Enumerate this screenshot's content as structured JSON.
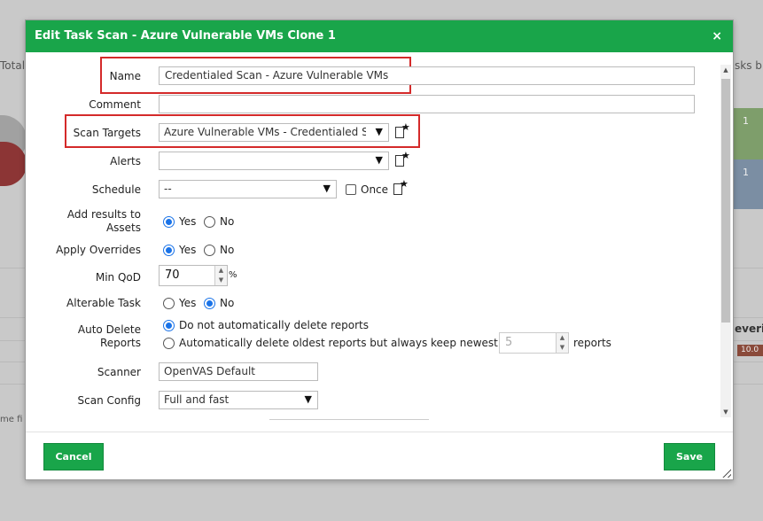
{
  "background": {
    "left_label": "Total:",
    "right_label": "sks b",
    "chart_values": [
      "1",
      "1"
    ],
    "right_header": "everit",
    "severity_badge": "10.0",
    "left_footer_fragment": "me fi"
  },
  "dialog": {
    "title": "Edit Task Scan - Azure Vulnerable VMs Clone 1",
    "close_label": "×",
    "fields": {
      "name": {
        "label": "Name",
        "value": "Credentialed Scan - Azure Vulnerable VMs"
      },
      "comment": {
        "label": "Comment",
        "value": ""
      },
      "scan_targets": {
        "label": "Scan Targets",
        "value": "Azure Vulnerable VMs - Credentialed Sc"
      },
      "alerts": {
        "label": "Alerts",
        "value": ""
      },
      "schedule": {
        "label": "Schedule",
        "value": "--",
        "once_label": "Once",
        "once_checked": false
      },
      "add_results": {
        "label_line1": "Add results to",
        "label_line2": "Assets",
        "options": [
          "Yes",
          "No"
        ],
        "selected": "Yes"
      },
      "apply_overrides": {
        "label": "Apply Overrides",
        "options": [
          "Yes",
          "No"
        ],
        "selected": "Yes"
      },
      "min_qod": {
        "label": "Min QoD",
        "value": "70",
        "unit": "%"
      },
      "alterable_task": {
        "label": "Alterable Task",
        "options": [
          "Yes",
          "No"
        ],
        "selected": "No"
      },
      "auto_delete": {
        "label_line1": "Auto Delete",
        "label_line2": "Reports",
        "option_none": "Do not automatically delete reports",
        "option_keep": "Automatically delete oldest reports but always keep newest",
        "keep_value": "5",
        "keep_unit": "reports",
        "selected": "none"
      },
      "scanner": {
        "label": "Scanner",
        "value": "OpenVAS Default"
      },
      "scan_config": {
        "label": "Scan Config",
        "value": "Full and fast"
      }
    },
    "icons": {
      "arrow": "▼",
      "star": "★",
      "scroll_up": "▲",
      "scroll_down": "▼"
    },
    "footer": {
      "cancel_label": "Cancel",
      "save_label": "Save"
    }
  },
  "colors": {
    "header_green": "#19a54a",
    "highlight_red": "#d42a2a",
    "radio_blue": "#1a73e8"
  }
}
